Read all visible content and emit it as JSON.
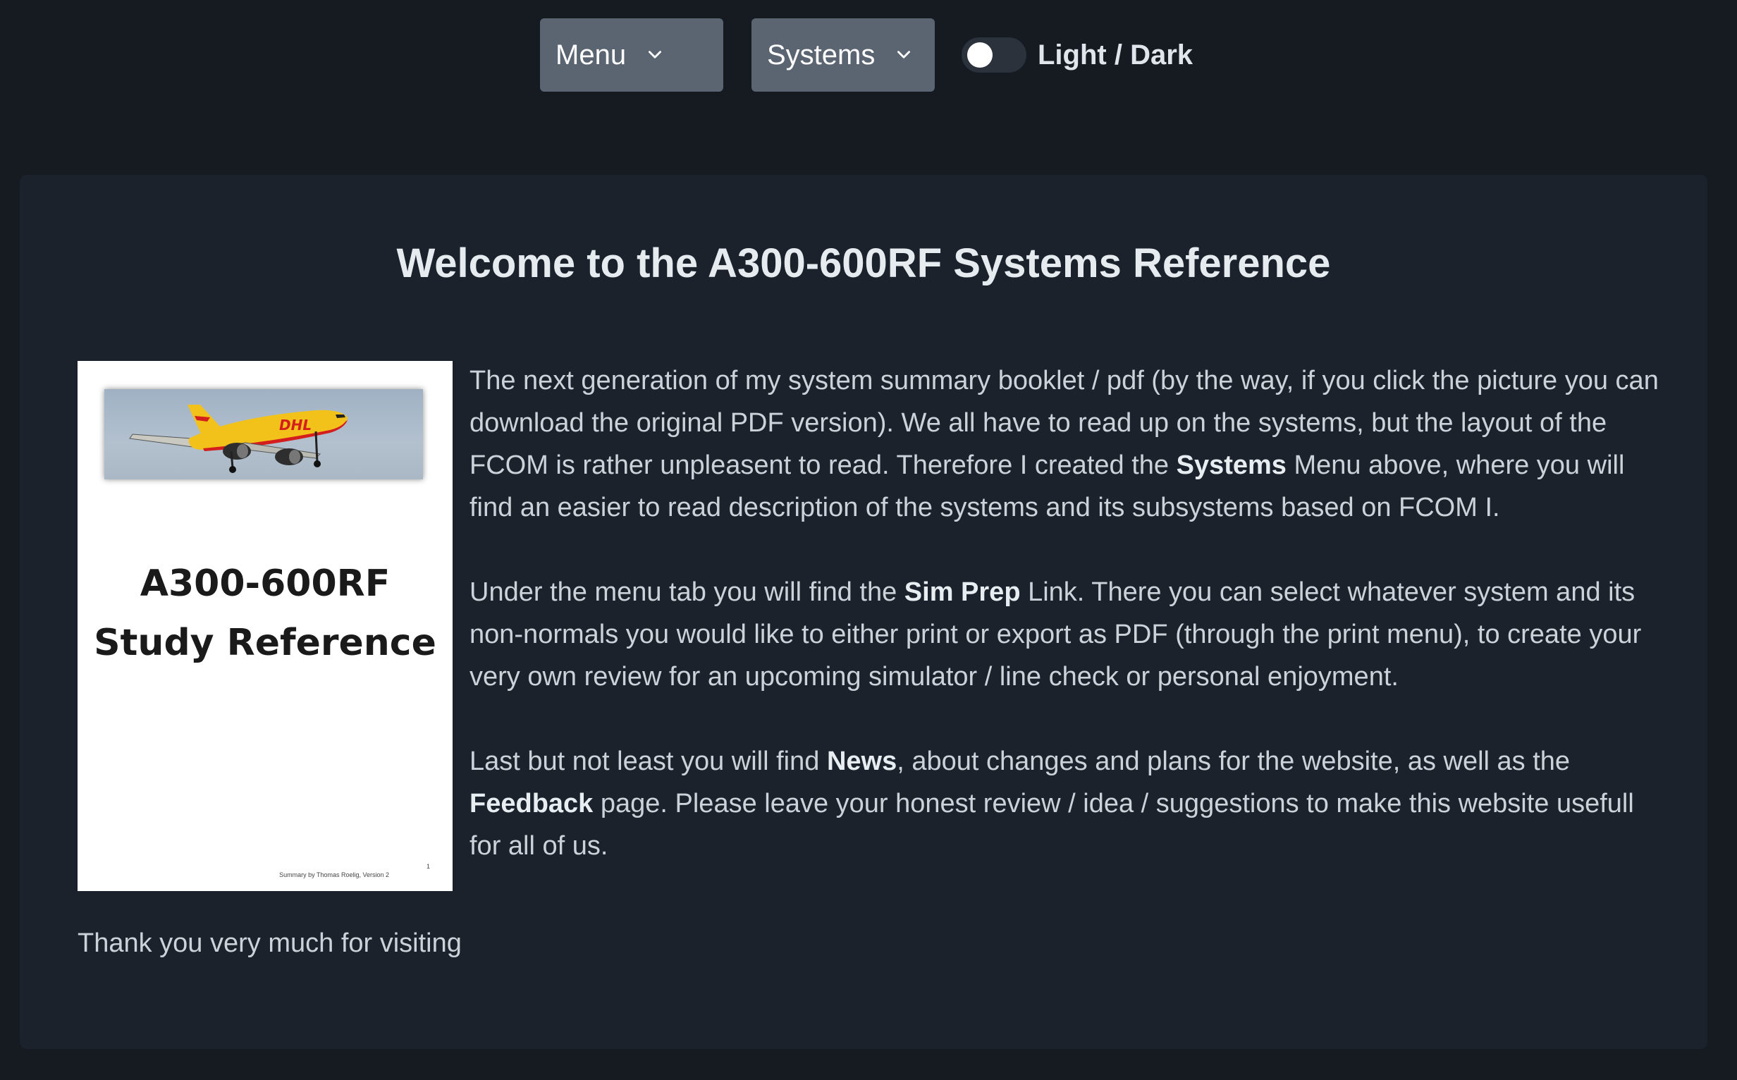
{
  "nav": {
    "menu_label": "Menu",
    "systems_label": "Systems",
    "theme_toggle_label": "Light / Dark"
  },
  "main": {
    "title": "Welcome to the A300-600RF Systems Reference",
    "cover": {
      "title_line1": "A300-600RF",
      "title_line2": "Study Reference",
      "footer": "Summary by Thomas Roelig, Version 2",
      "page_number": "1"
    },
    "para1": {
      "before": "The next generation of my system summary booklet / pdf (by the way, if you click the picture you can download the original PDF version). We all have to read up on the systems, but the layout of the FCOM is rather unpleasent to read. Therefore I created the ",
      "bold": "Systems",
      "after": " Menu above, where you will find an easier to read description of the systems and its subsystems based on FCOM I."
    },
    "para2": {
      "before": "Under the menu tab you will find the ",
      "bold": "Sim Prep",
      "after": " Link. There you can select whatever system and its non-normals you would like to either print or export as PDF (through the print menu), to create your very own review for an upcoming simulator / line check or personal enjoyment."
    },
    "para3": {
      "before": "Last but not least you will find ",
      "bold1": "News",
      "middle": ", about changes and plans for the website, as well as the ",
      "bold2": "Feedback",
      "after": " page. Please leave your honest review / idea / suggestions to make this website usefull for all of us."
    },
    "thanks": "Thank you very much for visiting"
  },
  "colors": {
    "page_bg": "#161b22",
    "card_bg": "#1b222b",
    "button_bg": "#5b6572",
    "text": "#cbd2d9",
    "title": "#e6ebf0"
  }
}
